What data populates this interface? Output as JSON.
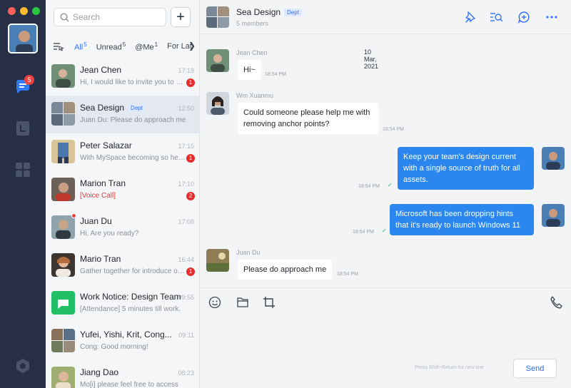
{
  "colors": {
    "rail": "#262f45",
    "accent": "#3370ff",
    "outgoing_bubble": "#2b86f0",
    "badge": "#e62e2e",
    "read_tick": "#27b36b"
  },
  "rail": {
    "badge_count": "5",
    "icons": [
      "chat-icon",
      "contacts-icon",
      "apps-icon",
      "settings-icon"
    ]
  },
  "sidebar": {
    "search_placeholder": "Search",
    "add_label": "+",
    "filters": [
      {
        "label": "All",
        "count": "5",
        "active": true
      },
      {
        "label": "Unread",
        "count": "5",
        "active": false
      },
      {
        "label": "@Me",
        "count": "1",
        "active": false
      },
      {
        "label": "For Lat",
        "count": "",
        "active": false
      }
    ],
    "conversations": [
      {
        "name": "Jean Chen",
        "tag": "",
        "time": "17:18",
        "preview": "Hi, I would like to invite you to m...",
        "badge": "1"
      },
      {
        "name": "Sea Design",
        "tag": "Dept",
        "time": "12:50",
        "preview": "Juan Du: Please do approach me",
        "badge": ""
      },
      {
        "name": "Peter Salazar",
        "tag": "",
        "time": "17:15",
        "preview": "With MySpace becoming so hea...",
        "badge": "1"
      },
      {
        "name": "Marion Tran",
        "tag": "",
        "time": "17:10",
        "preview": "[Voice Call]",
        "badge": "2"
      },
      {
        "name": "Juan Du",
        "tag": "",
        "time": "17:08",
        "preview": "Hi, Are you ready?",
        "badge": ""
      },
      {
        "name": "Mario Tran",
        "tag": "",
        "time": "16:44",
        "preview": "Gather together for introduce ou...",
        "badge": "1"
      },
      {
        "name": "Work Notice: Design Team",
        "tag": "",
        "time": "09:55",
        "preview": "[Attendance] 5 minutes till work.",
        "badge": ""
      },
      {
        "name": "Yufei, Yishi, Krit, Cong...",
        "tag": "",
        "time": "09:11",
        "preview": "Cong: Good morning!",
        "badge": ""
      },
      {
        "name": "Jiang Dao",
        "tag": "",
        "time": "08:23",
        "preview": "Mo[i] please feel free to access",
        "badge": ""
      }
    ]
  },
  "chat": {
    "title": "Sea Design",
    "tag": "Dept",
    "subtitle": "5 members",
    "date": "10 Mar, 2021",
    "messages": [
      {
        "sender": "Jean Chen",
        "text": "Hi~",
        "time": "18:54 PM",
        "direction": "in"
      },
      {
        "sender": "Wm Xuanmu",
        "text": "Could someone please help me with removing anchor points?",
        "time": "18:54 PM",
        "direction": "in"
      },
      {
        "sender": "",
        "text": "Keep your team's design current with a single source of truth for all assets.",
        "time": "18:54 PM",
        "direction": "out"
      },
      {
        "sender": "",
        "text": "Microsoft has been dropping hints that it's ready to launch Windows 11",
        "time": "18:54 PM",
        "direction": "out"
      },
      {
        "sender": "Juan Du",
        "text": "Please do approach me",
        "time": "18:54 PM",
        "direction": "in"
      }
    ],
    "composer": {
      "hint": "Press Shift+Return for new line",
      "send_label": "Send"
    }
  }
}
